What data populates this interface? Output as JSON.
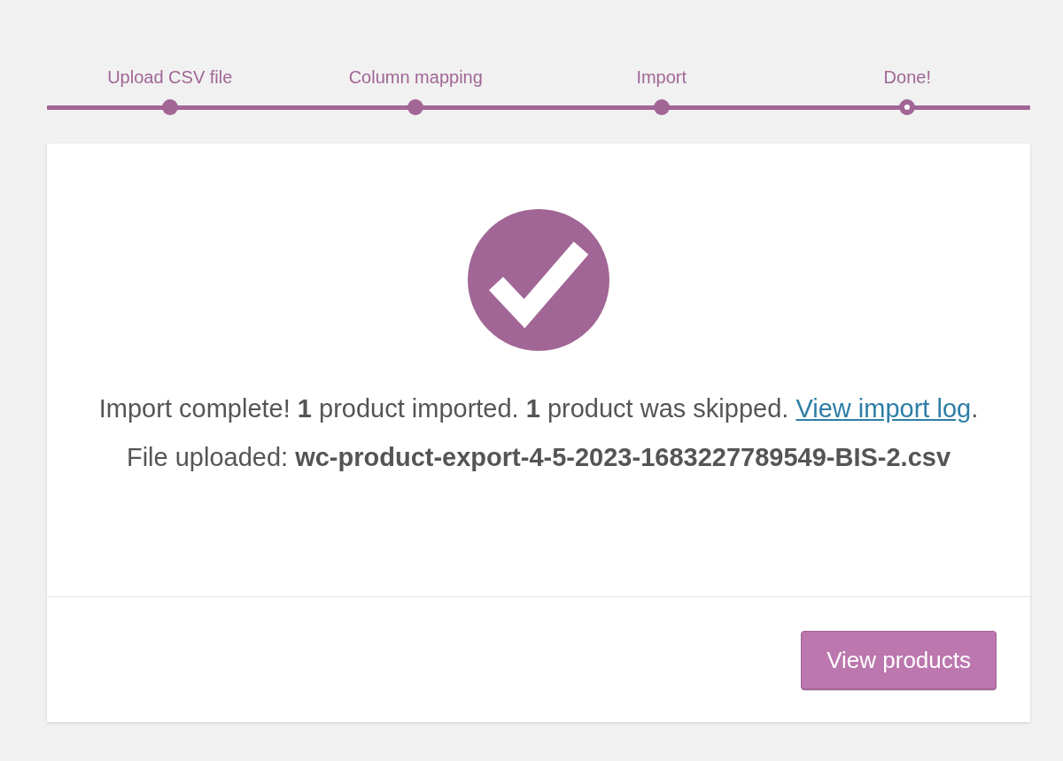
{
  "steps": [
    {
      "label": "Upload CSV file",
      "active": false
    },
    {
      "label": "Column mapping",
      "active": false
    },
    {
      "label": "Import",
      "active": false
    },
    {
      "label": "Done!",
      "active": true
    }
  ],
  "message": {
    "text_before": "Import complete! **1** product imported. **1** product was skipped.",
    "link": "View import log",
    "text_after": ". File uploaded: **wc-product-export-4-5-2023-1683227789549-BIS-2.csv**"
  },
  "buttons": [
    {
      "label": "View products"
    }
  ]
}
